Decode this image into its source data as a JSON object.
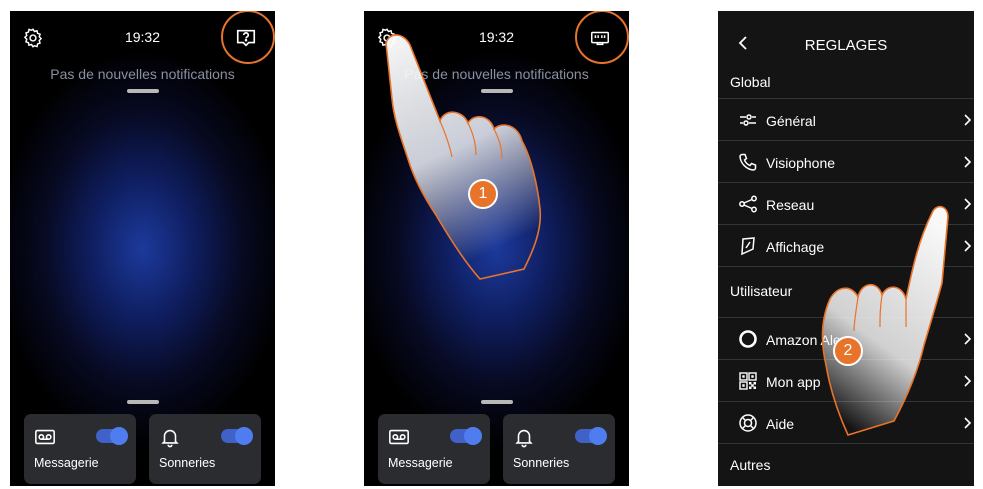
{
  "screen1": {
    "time": "19:32",
    "notification": "Pas de nouvelles notifications",
    "tiles": [
      {
        "label": "Messagerie",
        "icon": "voicemail-icon",
        "toggle_on": true
      },
      {
        "label": "Sonneries",
        "icon": "bell-icon",
        "toggle_on": true
      }
    ],
    "right_icon": "help-icon"
  },
  "screen2": {
    "time": "19:32",
    "notification": "Pas de nouvelles notifications",
    "tiles": [
      {
        "label": "Messagerie",
        "icon": "voicemail-icon",
        "toggle_on": true
      },
      {
        "label": "Sonneries",
        "icon": "bell-icon",
        "toggle_on": true
      }
    ],
    "right_icon": "network-icon",
    "step_badge": "1"
  },
  "settings": {
    "title": "REGLAGES",
    "sections": {
      "global": "Global",
      "user": "Utilisateur",
      "other": "Autres"
    },
    "global_items": [
      {
        "label": "Général",
        "icon": "sliders-icon"
      },
      {
        "label": "Visiophone",
        "icon": "phone-icon"
      },
      {
        "label": "Reseau",
        "icon": "share-icon"
      },
      {
        "label": "Affichage",
        "icon": "display-icon"
      }
    ],
    "user_items": [
      {
        "label": "Amazon Alexa",
        "icon": "alexa-icon"
      },
      {
        "label": "Mon app",
        "icon": "qr-code-icon"
      },
      {
        "label": "Aide",
        "icon": "lifebuoy-icon"
      }
    ],
    "step_badge": "2"
  },
  "colors": {
    "accent": "#e8732a",
    "toggle": "#4f7df0",
    "tile_bg": "#2b2c30",
    "settings_bg": "#141414"
  }
}
